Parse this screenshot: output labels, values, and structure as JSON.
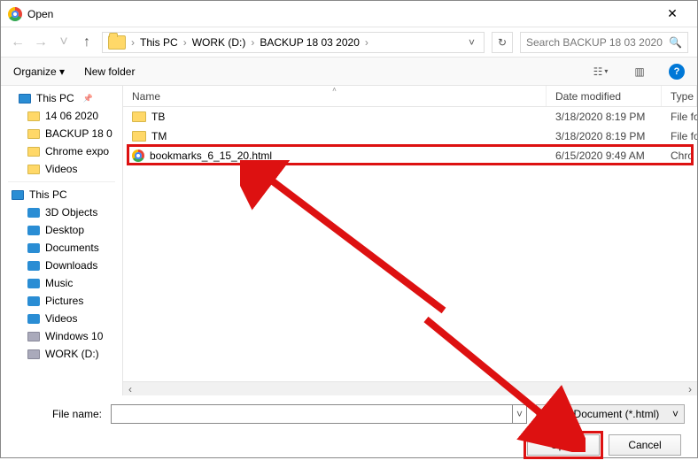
{
  "title": "Open",
  "breadcrumb": [
    "This PC",
    "WORK (D:)",
    "BACKUP 18 03 2020"
  ],
  "search_placeholder": "Search BACKUP 18 03 2020",
  "toolbar": {
    "organize": "Organize",
    "new_folder": "New folder"
  },
  "tree": {
    "quick": [
      {
        "label": "This PC",
        "icon": "monitor",
        "pin": true
      },
      {
        "label": "14 06 2020",
        "icon": "folder"
      },
      {
        "label": "BACKUP 18 0",
        "icon": "folder"
      },
      {
        "label": "Chrome expo",
        "icon": "folder"
      },
      {
        "label": "Videos",
        "icon": "folder"
      }
    ],
    "pc_label": "This PC",
    "pc": [
      {
        "label": "3D Objects",
        "color": "#2a8dd4"
      },
      {
        "label": "Desktop",
        "color": "#2a8dd4"
      },
      {
        "label": "Documents",
        "color": "#2a8dd4"
      },
      {
        "label": "Downloads",
        "color": "#2a8dd4"
      },
      {
        "label": "Music",
        "color": "#2a8dd4"
      },
      {
        "label": "Pictures",
        "color": "#2a8dd4"
      },
      {
        "label": "Videos",
        "color": "#2a8dd4"
      },
      {
        "label": "Windows 10",
        "color": "#aab",
        "disk": true
      },
      {
        "label": "WORK (D:)",
        "color": "#aab",
        "disk": true
      }
    ]
  },
  "columns": {
    "name": "Name",
    "date": "Date modified",
    "type": "Type"
  },
  "files": [
    {
      "name": "TB",
      "kind": "folder",
      "date": "3/18/2020 8:19 PM",
      "type": "File fo"
    },
    {
      "name": "TM",
      "kind": "folder",
      "date": "3/18/2020 8:19 PM",
      "type": "File fo"
    },
    {
      "name": "bookmarks_6_15_20.html",
      "kind": "chrome",
      "date": "6/15/2020 9:49 AM",
      "type": "Chro"
    }
  ],
  "file_name_label": "File name:",
  "filter": "HTML Document (*.html)",
  "buttons": {
    "open": "Open",
    "cancel": "Cancel"
  }
}
